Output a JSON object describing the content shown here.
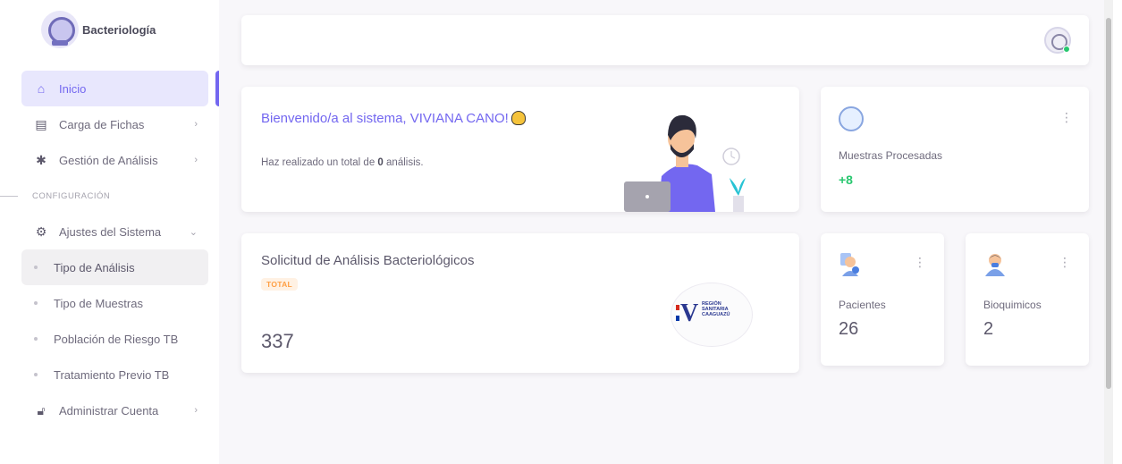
{
  "brand": {
    "name": "Bacteriología"
  },
  "sidebar": {
    "items": [
      {
        "label": "Inicio",
        "icon": "home-icon"
      },
      {
        "label": "Carga de Fichas",
        "icon": "file-icon"
      },
      {
        "label": "Gestión de Análisis",
        "icon": "gear-icon"
      }
    ],
    "section_label": "CONFIGURACIÓN",
    "settings": {
      "label": "Ajustes del Sistema",
      "icon": "settings-icon"
    },
    "sub_items": [
      {
        "label": "Tipo de Análisis"
      },
      {
        "label": "Tipo de Muestras"
      },
      {
        "label": "Población de Riesgo TB"
      },
      {
        "label": "Tratamiento Previo TB"
      }
    ],
    "account": {
      "label": "Administrar Cuenta",
      "icon": "lock-icon"
    }
  },
  "welcome": {
    "title": "Bienvenido/a al sistema, VIVIANA CANO!",
    "sub_prefix": "Haz realizado un total de ",
    "count": "0",
    "sub_suffix": " análisis."
  },
  "stats": {
    "muestras": {
      "label": "Muestras Procesadas",
      "trend": "+8"
    },
    "solicitud": {
      "title": "Solicitud de Análisis Bacteriológicos",
      "badge": "TOTAL",
      "value": "337"
    },
    "pacientes": {
      "label": "Pacientes",
      "value": "26"
    },
    "bioquimicos": {
      "label": "Bioquimicos",
      "value": "2"
    }
  },
  "region_logo": {
    "line1": "REGIÓN",
    "line2": "SANITARIA",
    "line3": "CAAGUAZÚ"
  },
  "colors": {
    "primary": "#7367f0",
    "success": "#28c76f",
    "warning": "#ff9f43"
  }
}
